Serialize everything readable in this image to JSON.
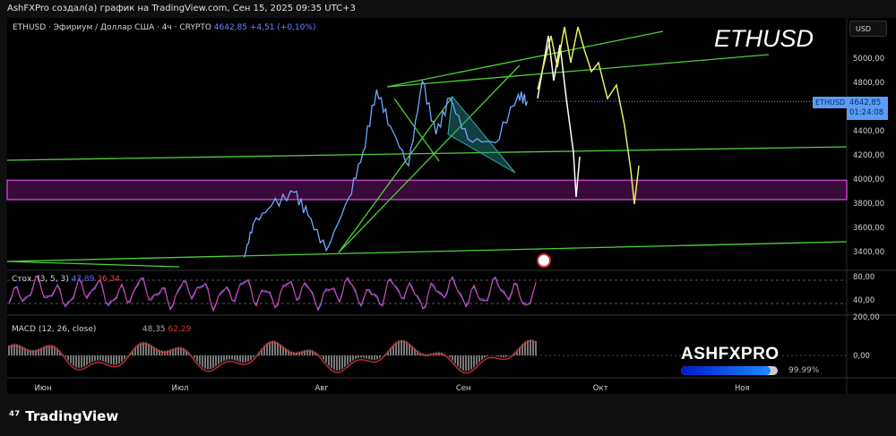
{
  "caption": "AshFXPro создал(а) график на TradingView.com, Сен 15, 2025 09:35 UTC+3",
  "legend": {
    "symbol": "ETHUSD · Эфириум / Доллар США · 4ч · CRYPTO",
    "price": "4642,85",
    "change": "+4,51 (+0,10%)"
  },
  "currency": "USD",
  "watermark": "ETHUSD",
  "price_tag": {
    "symbol": "ETHUSD",
    "price": "4642,85",
    "countdown": "01:24:08"
  },
  "stoch": {
    "label": "Стох. (3, 5, 3)",
    "k": "47,89",
    "d": "36,34",
    "ticks": [
      "80,00",
      "40,00"
    ]
  },
  "macd": {
    "label": "MACD (12, 26, close)",
    "macd": "48,35",
    "signal": "62,29",
    "ticks": [
      "200,00",
      "0,00"
    ]
  },
  "brand": {
    "name": "ASHFXPRO",
    "progress_percent": 99.99,
    "progress_label": "99.99%"
  },
  "footer": {
    "logo": "TradingView"
  },
  "colors": {
    "price": "#6fa8ff",
    "trend": "#4cd137",
    "zone": "#c040c0",
    "projection_white": "#ffffff",
    "projection_yellow": "#e6f060",
    "stoch_k": "#5b6cff",
    "stoch_d": "#e040a0"
  },
  "chart_data": {
    "type": "line",
    "ylim": [
      3300,
      5150
    ],
    "yticks": [
      "5000,00",
      "4800,00",
      "4400,00",
      "4200,00",
      "4000,00",
      "3800,00",
      "3600,00",
      "3400,00"
    ],
    "ytick_values": [
      5000,
      4800,
      4400,
      4200,
      4000,
      3800,
      3600,
      3400
    ],
    "xticks": [
      "Июн",
      "Июл",
      "Авг",
      "Сен",
      "Окт",
      "Ноя"
    ],
    "x": [
      "2025-07-15",
      "2025-07-17",
      "2025-07-21",
      "2025-07-26",
      "2025-07-29",
      "2025-08-02",
      "2025-08-07",
      "2025-08-10",
      "2025-08-13",
      "2025-08-16",
      "2025-08-20",
      "2025-08-23",
      "2025-08-26",
      "2025-08-29",
      "2025-09-02",
      "2025-09-08",
      "2025-09-13",
      "2025-09-15"
    ],
    "values": [
      3350,
      3630,
      3780,
      3890,
      3700,
      3410,
      3850,
      4220,
      4740,
      4440,
      4110,
      4810,
      4370,
      4670,
      4330,
      4300,
      4700,
      4642.85
    ],
    "zone": [
      3830,
      3990
    ]
  }
}
